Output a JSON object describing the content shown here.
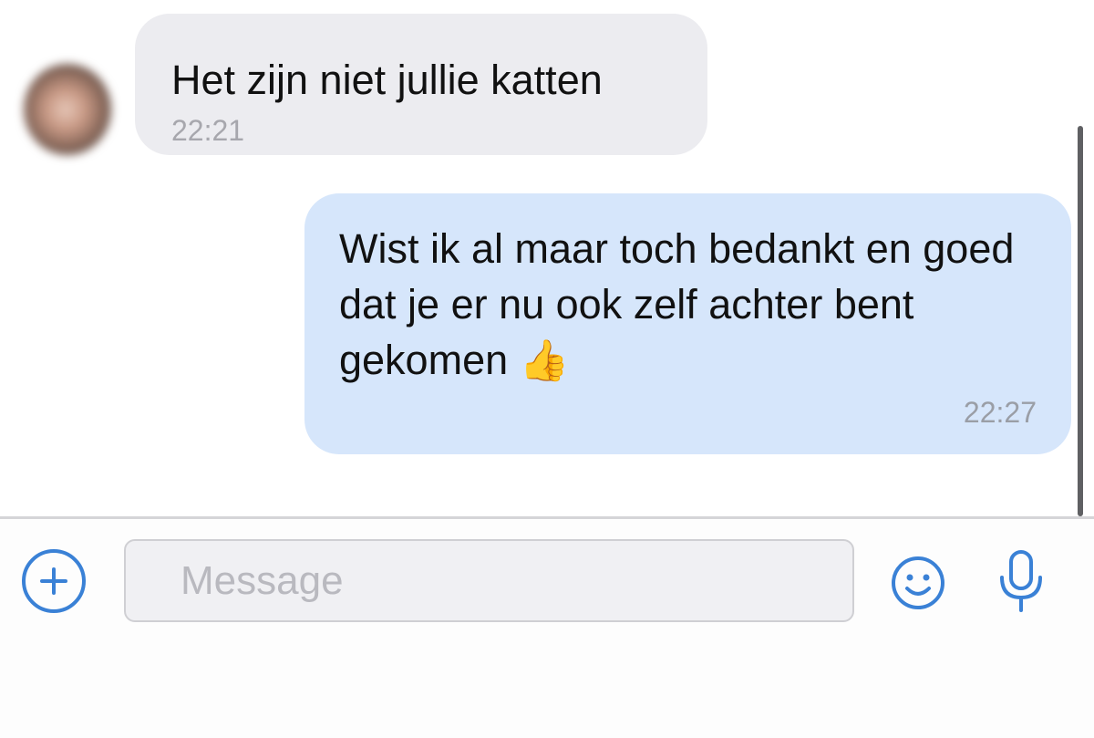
{
  "messages": {
    "incoming": {
      "text": "Het zijn niet jullie katten",
      "time": "22:21"
    },
    "outgoing": {
      "text": "Wist ik al maar toch bedankt en goed dat je er nu ook zelf achter bent gekomen",
      "emoji": "👍",
      "time": "22:27"
    }
  },
  "composer": {
    "placeholder": "Message"
  },
  "icons": {
    "add": "plus-circle-icon",
    "emoji": "smiley-icon",
    "mic": "microphone-icon"
  },
  "colors": {
    "accent": "#3a81d6",
    "incoming_bubble": "#ececf0",
    "outgoing_bubble": "#d6e6fb"
  }
}
